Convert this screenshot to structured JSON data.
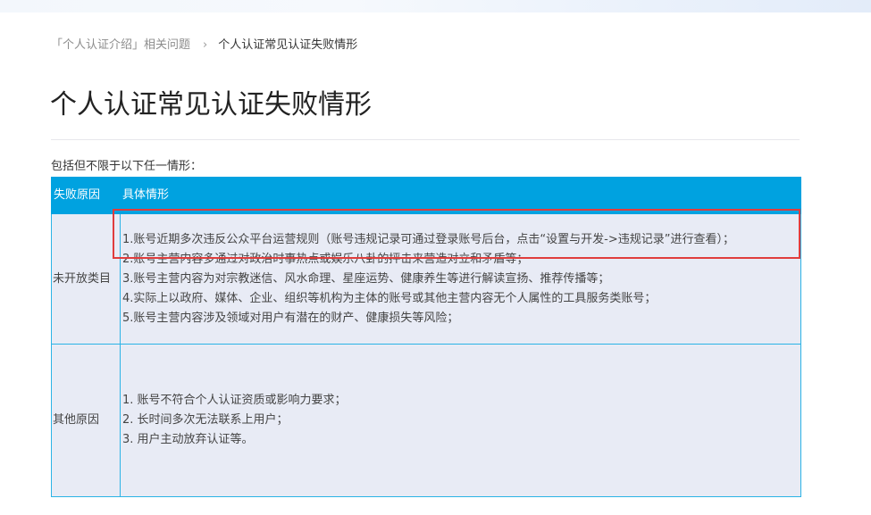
{
  "breadcrumb": {
    "parent": "「个人认证介绍」相关问题",
    "separator": "›",
    "current": "个人认证常见认证失败情形"
  },
  "page_title": "个人认证常见认证失败情形",
  "intro": "包括但不限于以下任一情形：",
  "table": {
    "headers": [
      "失败原因",
      "具体情形"
    ],
    "rows": [
      {
        "reason": "未开放类目",
        "items": [
          "1.账号近期多次违反公众平台运营规则（账号违规记录可通过登录账号后台，点击“设置与开发->违规记录”进行查看）；",
          "2.账号主营内容多通过对政治时事热点或娱乐八卦的抨击来营造对立和矛盾等；",
          "3.账号主营内容为对宗教迷信、风水命理、星座运势、健康养生等进行解读宣扬、推荐传播等；",
          "4.实际上以政府、媒体、企业、组织等机构为主体的账号或其他主营内容无个人属性的工具服务类账号；",
          "5.账号主营内容涉及领域对用户有潜在的财产、健康损失等风险；"
        ]
      },
      {
        "reason": "其他原因",
        "items": [
          "1. 账号不符合个人认证资质或影响力要求；",
          "2. 长时间多次无法联系上用户；",
          "3. 用户主动放弃认证等。"
        ]
      }
    ]
  },
  "colors": {
    "header_bg": "#00a2e0",
    "cell_bg": "#e8ebf5",
    "highlight": "#e03d3d"
  }
}
